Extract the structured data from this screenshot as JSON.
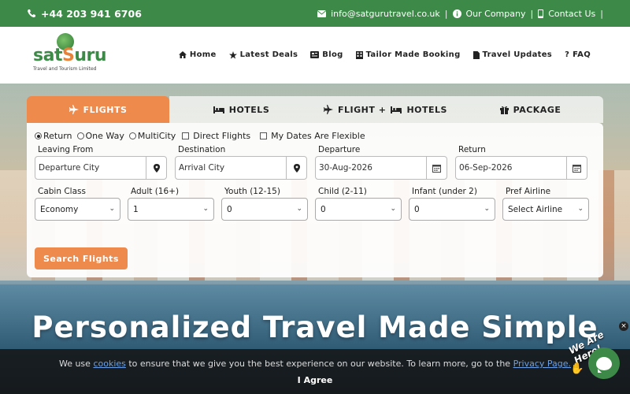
{
  "topbar": {
    "phone": "+44 203 941 6706",
    "email": "info@satgurutravel.co.uk",
    "company": "Our Company",
    "contact": "Contact Us",
    "sep": "|"
  },
  "logo": {
    "word_a": "sat",
    "word_b": "S",
    "word_c": "uru",
    "tagline": "Travel and Tourism Limited"
  },
  "nav": {
    "items": [
      {
        "label": "Home",
        "icon": "home-icon"
      },
      {
        "label": "Latest Deals",
        "icon": "star-icon"
      },
      {
        "label": "Blog",
        "icon": "newspaper-icon"
      },
      {
        "label": "Tailor Made Booking",
        "icon": "building-icon"
      },
      {
        "label": "Travel Updates",
        "icon": "file-icon"
      },
      {
        "label": "FAQ",
        "icon": "question-icon"
      }
    ]
  },
  "tabs": [
    {
      "label": "FLIGHTS",
      "icon": "plane-icon",
      "active": true
    },
    {
      "label": "HOTELS",
      "icon": "bed-icon",
      "active": false
    },
    {
      "label": "FLIGHT +",
      "label2": "HOTELS",
      "icon": "plane-bed-icon",
      "active": false
    },
    {
      "label": "PACKAGE",
      "icon": "gift-icon",
      "active": false
    }
  ],
  "trip_options": {
    "return": "Return",
    "one_way": "One Way",
    "multi_city": "MultiCity",
    "direct": "Direct Flights",
    "flexible": "My Dates Are Flexible"
  },
  "form": {
    "leaving_label": "Leaving From",
    "leaving_placeholder": "Departure City",
    "destination_label": "Destination",
    "destination_placeholder": "Arrival City",
    "departure_label": "Departure",
    "departure_value": "30-Aug-2026",
    "return_label": "Return",
    "return_value": "06-Sep-2026",
    "cabin_label": "Cabin Class",
    "cabin_value": "Economy",
    "adult_label": "Adult (16+)",
    "adult_value": "1",
    "youth_label": "Youth (12-15)",
    "youth_value": "0",
    "child_label": "Child (2-11)",
    "child_value": "0",
    "infant_label": "Infant (under 2)",
    "infant_value": "0",
    "airline_label": "Pref Airline",
    "airline_value": "Select Airline",
    "search_button": "Search Flights"
  },
  "hero": {
    "headline": "Personalized Travel Made Simple"
  },
  "cookie": {
    "msg_pre": "We use ",
    "cookies_link": "cookies",
    "msg_mid": " to ensure that we give you the best experience on our website. To learn more, go to the ",
    "privacy_link": "Privacy Page.",
    "agree": "I Agree"
  },
  "chat": {
    "badge": "We Are Here!",
    "close": "×"
  },
  "colors": {
    "brand_green": "#3d8a48",
    "accent_orange": "#ee8a4c"
  }
}
